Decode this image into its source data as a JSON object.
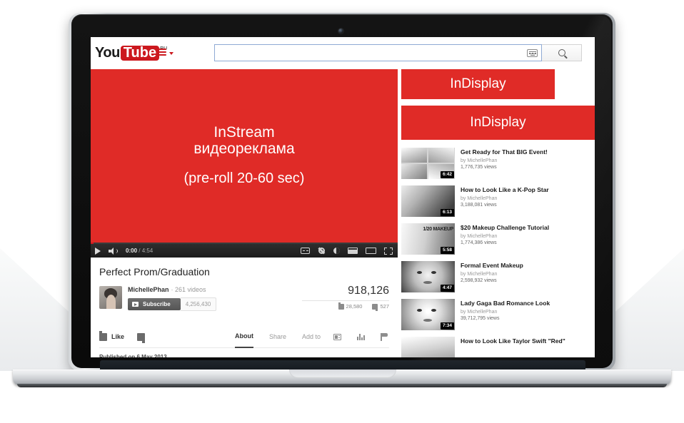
{
  "header": {
    "logo_you": "You",
    "logo_tube": "Tube",
    "logo_locale": "RU",
    "menu_icon": "hamburger-icon",
    "search_value": "",
    "search_placeholder": "",
    "keyboard_icon": "keyboard-icon",
    "search_icon": "search-icon"
  },
  "instream_ad": {
    "line1": "InStream",
    "line2": "видеореклама",
    "line3": "(pre-roll 20-60 sec)",
    "color": "#e02b27"
  },
  "player": {
    "play_icon": "play-icon",
    "volume_icon": "volume-icon",
    "current_time": "0:00",
    "separator": " / ",
    "duration": "4:54",
    "cc_icon": "closed-caption-icon",
    "settings_icon": "gear-icon",
    "quality_icon": "half-circle-icon",
    "theater_icon": "theater-mode-icon",
    "wide_icon": "wide-mode-icon",
    "fullscreen_icon": "fullscreen-icon"
  },
  "video": {
    "title": "Perfect Prom/Graduation",
    "avatar": "channel-avatar",
    "channel": "MichellePhan",
    "channel_videos": "· 261 videos",
    "subscribe_label": "Subscribe",
    "subscribe_icon": "youtube-play-icon",
    "subscriber_count": "4,256,430",
    "views": "918,126",
    "likes": "28,580",
    "dislikes": "527",
    "like_icon": "thumb-up-icon",
    "dislike_icon": "thumb-down-icon",
    "published": "Published on 6 May 2013"
  },
  "actions": {
    "like_label": "Like",
    "like_icon": "thumb-up-icon",
    "dislike_icon": "thumb-down-icon",
    "tabs": [
      {
        "label": "About",
        "active": true
      },
      {
        "label": "Share",
        "active": false
      },
      {
        "label": "Add to",
        "active": false
      }
    ],
    "icons": [
      "tv-icon",
      "statistics-icon",
      "flag-icon"
    ]
  },
  "indisplay_ads": [
    {
      "label": "InDisplay",
      "color": "#e02b27",
      "size": "small"
    },
    {
      "label": "InDisplay",
      "color": "#e02b27",
      "size": "large"
    }
  ],
  "sidebar_videos": [
    {
      "title": "Get Ready for That BIG Event!",
      "by": "by MichellePhan",
      "views": "1,776,735 views",
      "duration": "6:42",
      "thumb": "grid4"
    },
    {
      "title": "How to Look Like a K-Pop Star",
      "by": "by MichellePhan",
      "views": "3,188,081 views",
      "duration": "6:13",
      "thumb": "k1"
    },
    {
      "title": "$20 Makeup Challenge Tutorial",
      "by": "by MichellePhan",
      "views": "1,774,386 views",
      "duration": "5:58",
      "thumb": "k2",
      "thumb_text": "1/20 MAKEUP"
    },
    {
      "title": "Formal Event Makeup",
      "by": "by MichellePhan",
      "views": "2,598,932 views",
      "duration": "4:47",
      "thumb": "k3"
    },
    {
      "title": "Lady Gaga Bad Romance Look",
      "by": "by MichellePhan",
      "views": "39,712,795 views",
      "duration": "7:34",
      "thumb": "k4"
    },
    {
      "title": "How to Look Like Taylor Swift \"Red\"",
      "by": "",
      "views": "",
      "duration": "",
      "thumb": "k5"
    }
  ]
}
